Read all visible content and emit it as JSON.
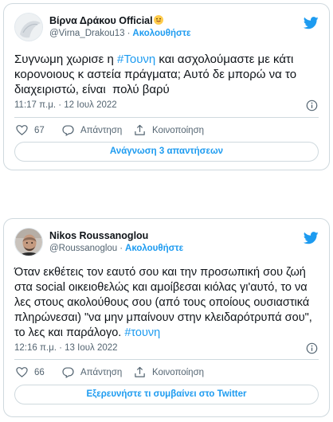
{
  "tweets": [
    {
      "display_name": "Βίρνα Δράκου Official",
      "emoji": "😛",
      "handle": "@Virna_Drakou13",
      "separator": "·",
      "follow_label": "Ακολουθήστε",
      "text_parts": [
        "Συγνωμη χωρισε η ",
        "#Τουνη",
        " και ασχολούμαστε με κάτι κορονοιους κ αστεία πράγματα; Αυτό δε μπορώ να το διαχειριστώ, είναι  πολύ βαρύ"
      ],
      "timestamp": "11:17 π.μ. · 12 Ιουλ 2022",
      "like_count": "67",
      "reply_label": "Απάντηση",
      "share_label": "Κοινοποίηση",
      "cta_label": "Ανάγνωση 3 απαντήσεων"
    },
    {
      "display_name": "Nikos Roussanoglou",
      "handle": "@Roussanoglou",
      "separator": "·",
      "follow_label": "Ακολουθήστε",
      "text_parts": [
        "Όταν εκθέτεις τον εαυτό σου και την προσωπική σου ζωή στα social οικειοθελώς και αμοίβεσαι κιόλας γι'αυτό, το να λες στους ακολούθους σου (από τους οποίους ουσιαστικά πληρώνεσαι) \"να μην μπαίνουν στην κλειδαρότρυπά σου\", το λες και παράλογο. ",
        "#τουνη"
      ],
      "timestamp": "12:16 π.μ. · 13 Ιουλ 2022",
      "like_count": "66",
      "reply_label": "Απάντηση",
      "share_label": "Κοινοποίηση",
      "cta_label": "Εξερευνήστε τι συμβαίνει στο Twitter"
    }
  ],
  "icons": {
    "brand": "twitter-bird-icon",
    "like": "heart-icon",
    "reply": "speech-bubble-icon",
    "share": "share-icon",
    "info": "info-icon"
  },
  "colors": {
    "accent": "#1d9bf0",
    "text": "#0f1419",
    "muted": "#536471",
    "border": "#cfd9de"
  }
}
